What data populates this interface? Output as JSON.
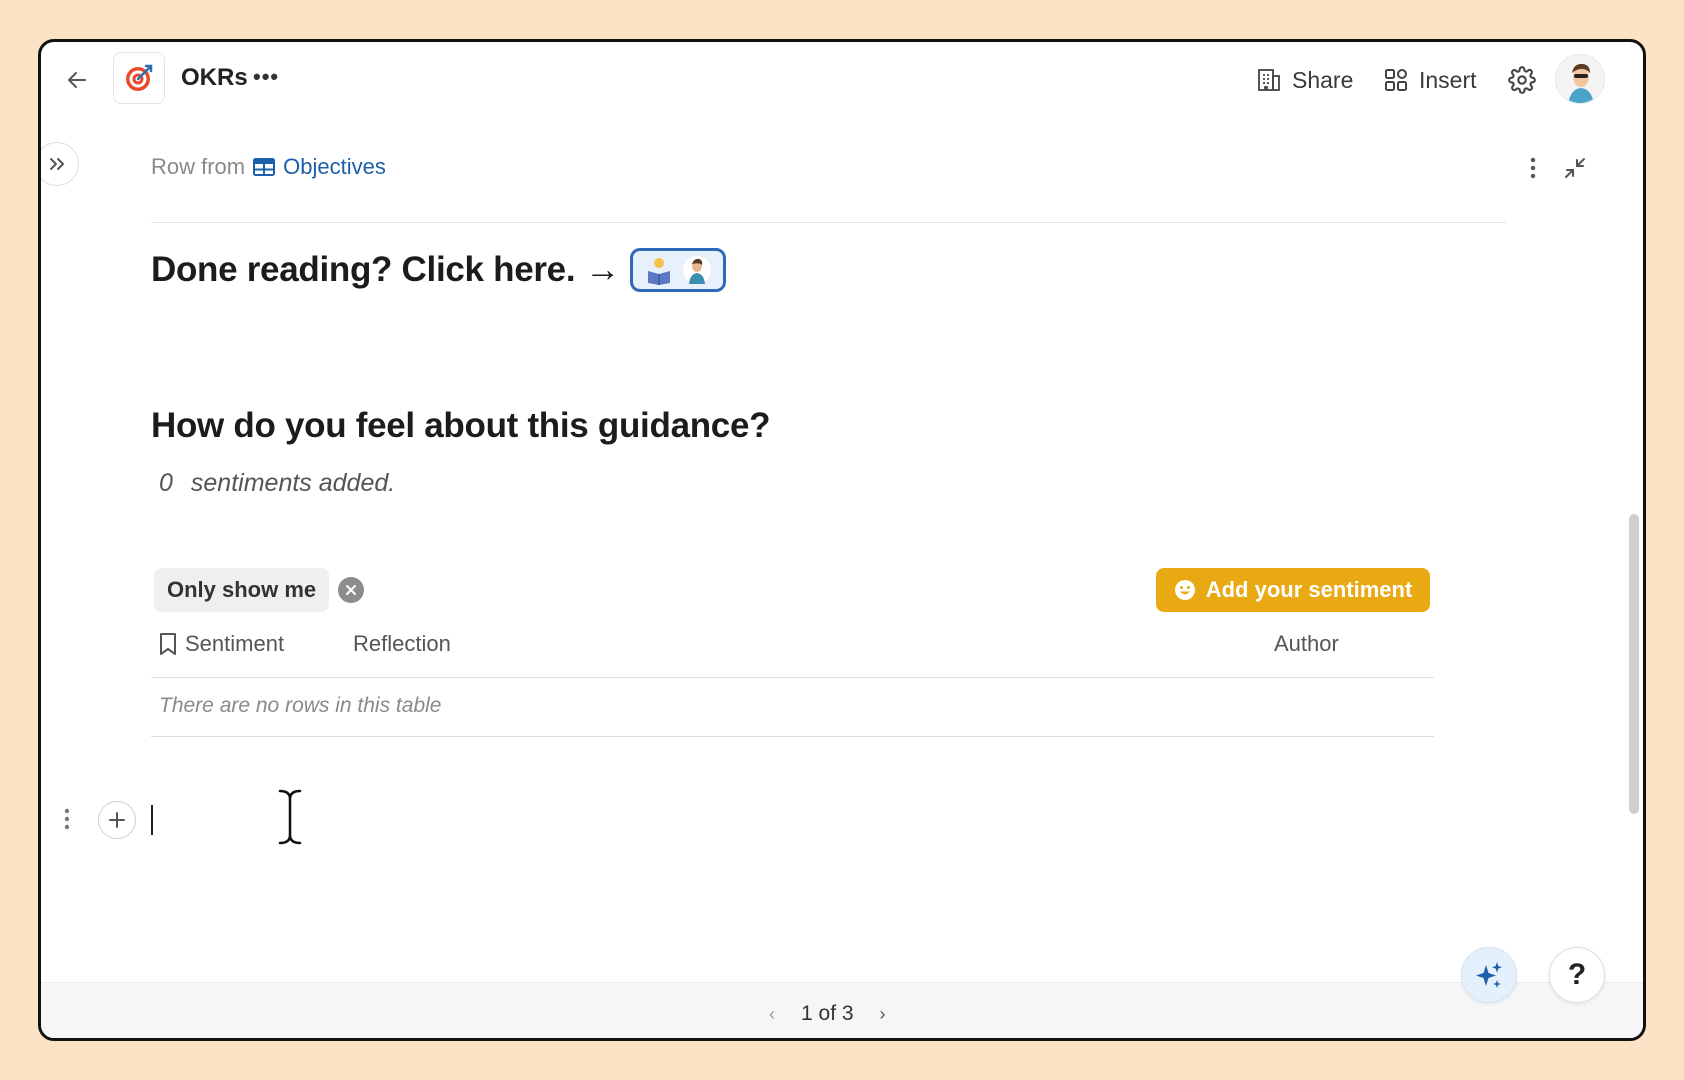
{
  "header": {
    "doc_title": "OKRs",
    "doc_menu": "•••",
    "share_label": "Share",
    "insert_label": "Insert"
  },
  "breadcrumb": {
    "prefix": "Row from",
    "table_name": "Objectives"
  },
  "content": {
    "done_heading": "Done reading? Click here.",
    "done_arrow": "→",
    "feel_heading": "How do you feel about this guidance?",
    "sentiment_count": "0",
    "sentiment_suffix": "sentiments added."
  },
  "filter": {
    "chip_label": "Only show me"
  },
  "actions": {
    "add_sentiment_label": "Add your sentiment"
  },
  "table": {
    "columns": [
      "Sentiment",
      "Reflection",
      "Author"
    ],
    "empty_message": "There are no rows in this table"
  },
  "footer": {
    "page_indicator": "1 of 3",
    "prev": "‹",
    "next": "›",
    "help_label": "?"
  },
  "colors": {
    "accent_yellow": "#e8a912",
    "link_blue": "#1d5fa8",
    "page_bg": "#fde3c6"
  },
  "icons": [
    "back-arrow-icon",
    "target-icon",
    "building-icon",
    "grid-icon",
    "gear-icon",
    "expand-icon",
    "table-icon",
    "more-vertical-icon",
    "collapse-icon",
    "reading-emoji-icon",
    "smiley-icon",
    "bookmark-icon",
    "drag-handle-icon",
    "plus-icon",
    "sparkle-icon"
  ]
}
